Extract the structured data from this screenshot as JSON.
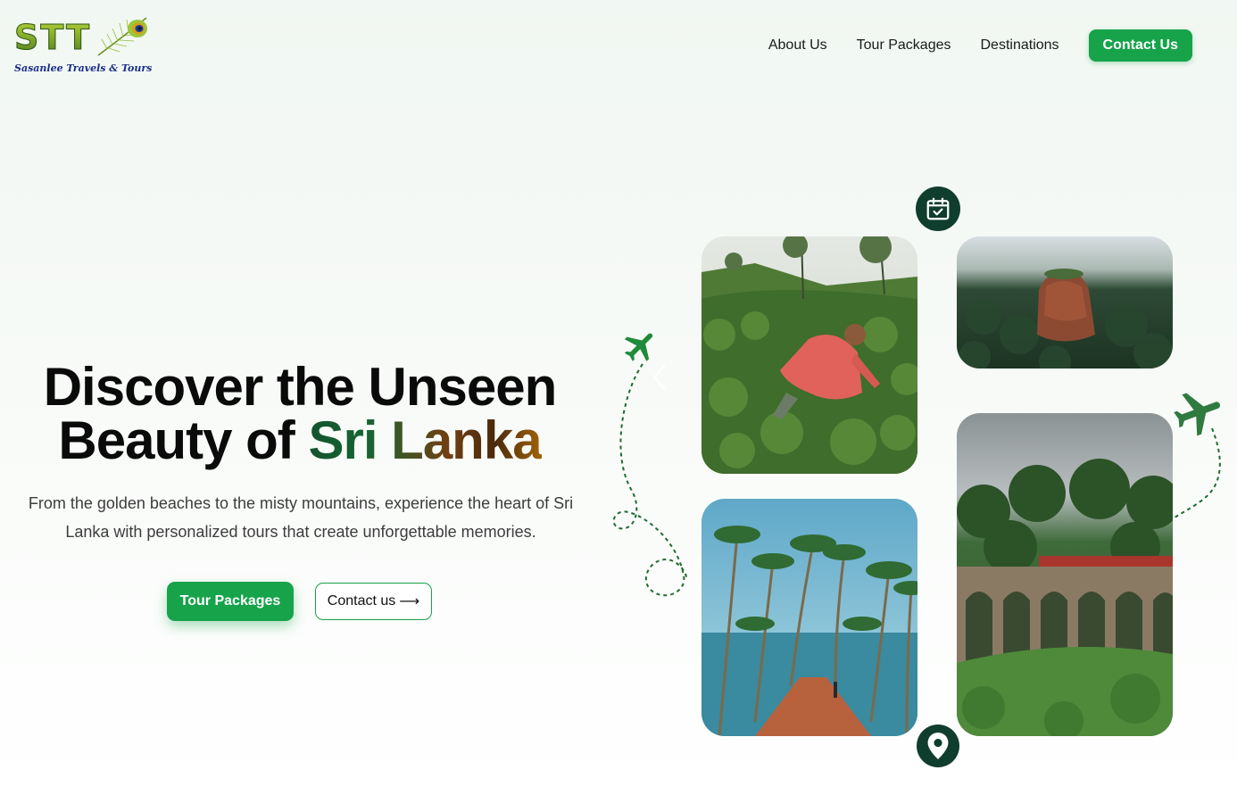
{
  "brand": {
    "logo_text": "STT",
    "tagline": "Sasanlee Travels & Tours"
  },
  "nav": {
    "links": [
      "About Us",
      "Tour Packages",
      "Destinations"
    ],
    "cta": "Contact Us"
  },
  "hero": {
    "title_line1": "Discover the Unseen",
    "title_line2_prefix": "Beauty of ",
    "title_line2_accent": "Sri Lanka",
    "description": "From the golden beaches to the misty mountains, experience the heart of Sri Lanka with personalized tours that create unforgettable memories.",
    "primary_button": "Tour Packages",
    "secondary_button": "Contact us",
    "secondary_arrow": "⟶"
  },
  "gallery": {
    "icons": [
      "calendar-check-icon",
      "location-pin-icon",
      "airplane-icon",
      "airplane-icon"
    ]
  },
  "colors": {
    "accent_green": "#16a34a",
    "badge_dark": "#0f3d2e"
  }
}
